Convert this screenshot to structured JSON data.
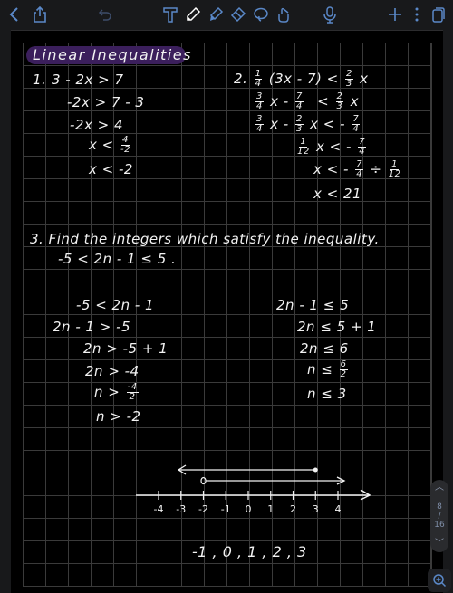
{
  "toolbar": {
    "left": [
      {
        "name": "back-icon"
      },
      {
        "name": "share-icon"
      },
      {
        "name": "undo-icon"
      }
    ],
    "tools": [
      {
        "name": "text-tool-icon"
      },
      {
        "name": "pen-tool-icon",
        "active": true
      },
      {
        "name": "highlighter-tool-icon"
      },
      {
        "name": "eraser-tool-icon"
      },
      {
        "name": "lasso-tool-icon"
      },
      {
        "name": "hand-gesture-icon"
      }
    ],
    "right": [
      {
        "name": "microphone-icon"
      },
      {
        "name": "add-icon"
      },
      {
        "name": "more-icon"
      },
      {
        "name": "pages-icon"
      }
    ],
    "accent_color": "#5a88c8"
  },
  "note": {
    "title": "Linear Inequalities",
    "title_highlight_color": "#3b1f5c",
    "problem1": {
      "label": "1.",
      "lines": [
        "3 - 2x > 7",
        "-2x > 7 - 3",
        "-2x > 4",
        "x <",
        "x < -2"
      ],
      "frac_line": {
        "prefix": "x <",
        "num": "4",
        "den": "-2"
      }
    },
    "problem2": {
      "label": "2.",
      "line1": {
        "frac1_num": "1",
        "frac1_den": "4",
        "middle": "(3x - 7) <",
        "frac2_num": "2",
        "frac2_den": "3",
        "suffix": "x"
      },
      "line2": {
        "a_num": "3",
        "a_den": "4",
        "a_mid": "x -",
        "b_num": "7",
        "b_den": "4",
        "b_mid": "<",
        "c_num": "2",
        "c_den": "3",
        "suffix": "x"
      },
      "line3": {
        "a_num": "3",
        "a_den": "4",
        "a_mid": "x -",
        "b_num": "2",
        "b_den": "3",
        "b_mid": "x < -",
        "c_num": "7",
        "c_den": "4"
      },
      "line4": {
        "a_num": "1",
        "a_den": "12",
        "mid": "x < -",
        "b_num": "7",
        "b_den": "4"
      },
      "line5": {
        "prefix": "x < -",
        "a_num": "7",
        "a_den": "4",
        "mid": "÷",
        "b_num": "1",
        "b_den": "12"
      },
      "line6": "x < 21"
    },
    "problem3": {
      "prompt": "3. Find the integers which satisfy the inequality.",
      "inequality": "-5 < 2n - 1 ≤ 5 .",
      "left_steps": [
        "-5 < 2n - 1",
        "2n - 1 > -5",
        "2n > -5 + 1",
        "2n > -4",
        "n >",
        "n > -2"
      ],
      "left_frac": {
        "num": "-4",
        "den": "2"
      },
      "right_steps": [
        "2n - 1 ≤ 5",
        "2n ≤ 5 + 1",
        "2n ≤ 6",
        "n ≤",
        "n ≤ 3"
      ],
      "right_frac": {
        "num": "6",
        "den": "2"
      },
      "number_line": {
        "ticks": [
          "-4",
          "-3",
          "-2",
          "-1",
          "0",
          "1",
          "2",
          "3",
          "4"
        ],
        "upper_ray": {
          "to": 3,
          "endpoint": "closed",
          "direction": "left"
        },
        "lower_ray": {
          "from": -2,
          "endpoint": "open",
          "direction": "right"
        }
      },
      "answer": "-1 , 0 , 1 , 2 , 3"
    }
  },
  "page_nav": {
    "current": "8",
    "separator": "/",
    "total": "16"
  }
}
